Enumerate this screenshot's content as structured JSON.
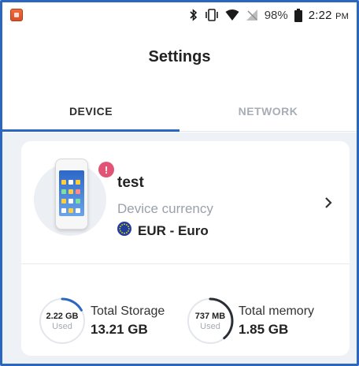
{
  "status_bar": {
    "battery_percent": "98%",
    "time": "2:22",
    "time_suffix": "PM",
    "icons": [
      "app-icon",
      "bluetooth-icon",
      "vibrate-icon",
      "wifi-icon",
      "no-signal-icon",
      "battery-icon"
    ]
  },
  "page": {
    "title": "Settings"
  },
  "tabs": [
    {
      "label": "DEVICE",
      "active": true
    },
    {
      "label": "NETWORK",
      "active": false
    }
  ],
  "device": {
    "name": "test",
    "currency_label": "Device currency",
    "currency_value": "EUR - Euro",
    "alert_badge": "!",
    "icons": [
      "device-image",
      "alert-icon",
      "eu-flag-icon",
      "chevron-right-icon"
    ]
  },
  "storage": {
    "used": "2.22 GB",
    "used_label": "Used",
    "label": "Total Storage",
    "total": "13.21 GB",
    "used_fraction": 0.168
  },
  "memory": {
    "used": "737 MB",
    "used_label": "Used",
    "label": "Total memory",
    "total": "1.85 GB",
    "used_fraction": 0.39
  },
  "colors": {
    "accent": "#2b66c0",
    "badge": "#e25475",
    "content_bg": "#eef1f6"
  }
}
